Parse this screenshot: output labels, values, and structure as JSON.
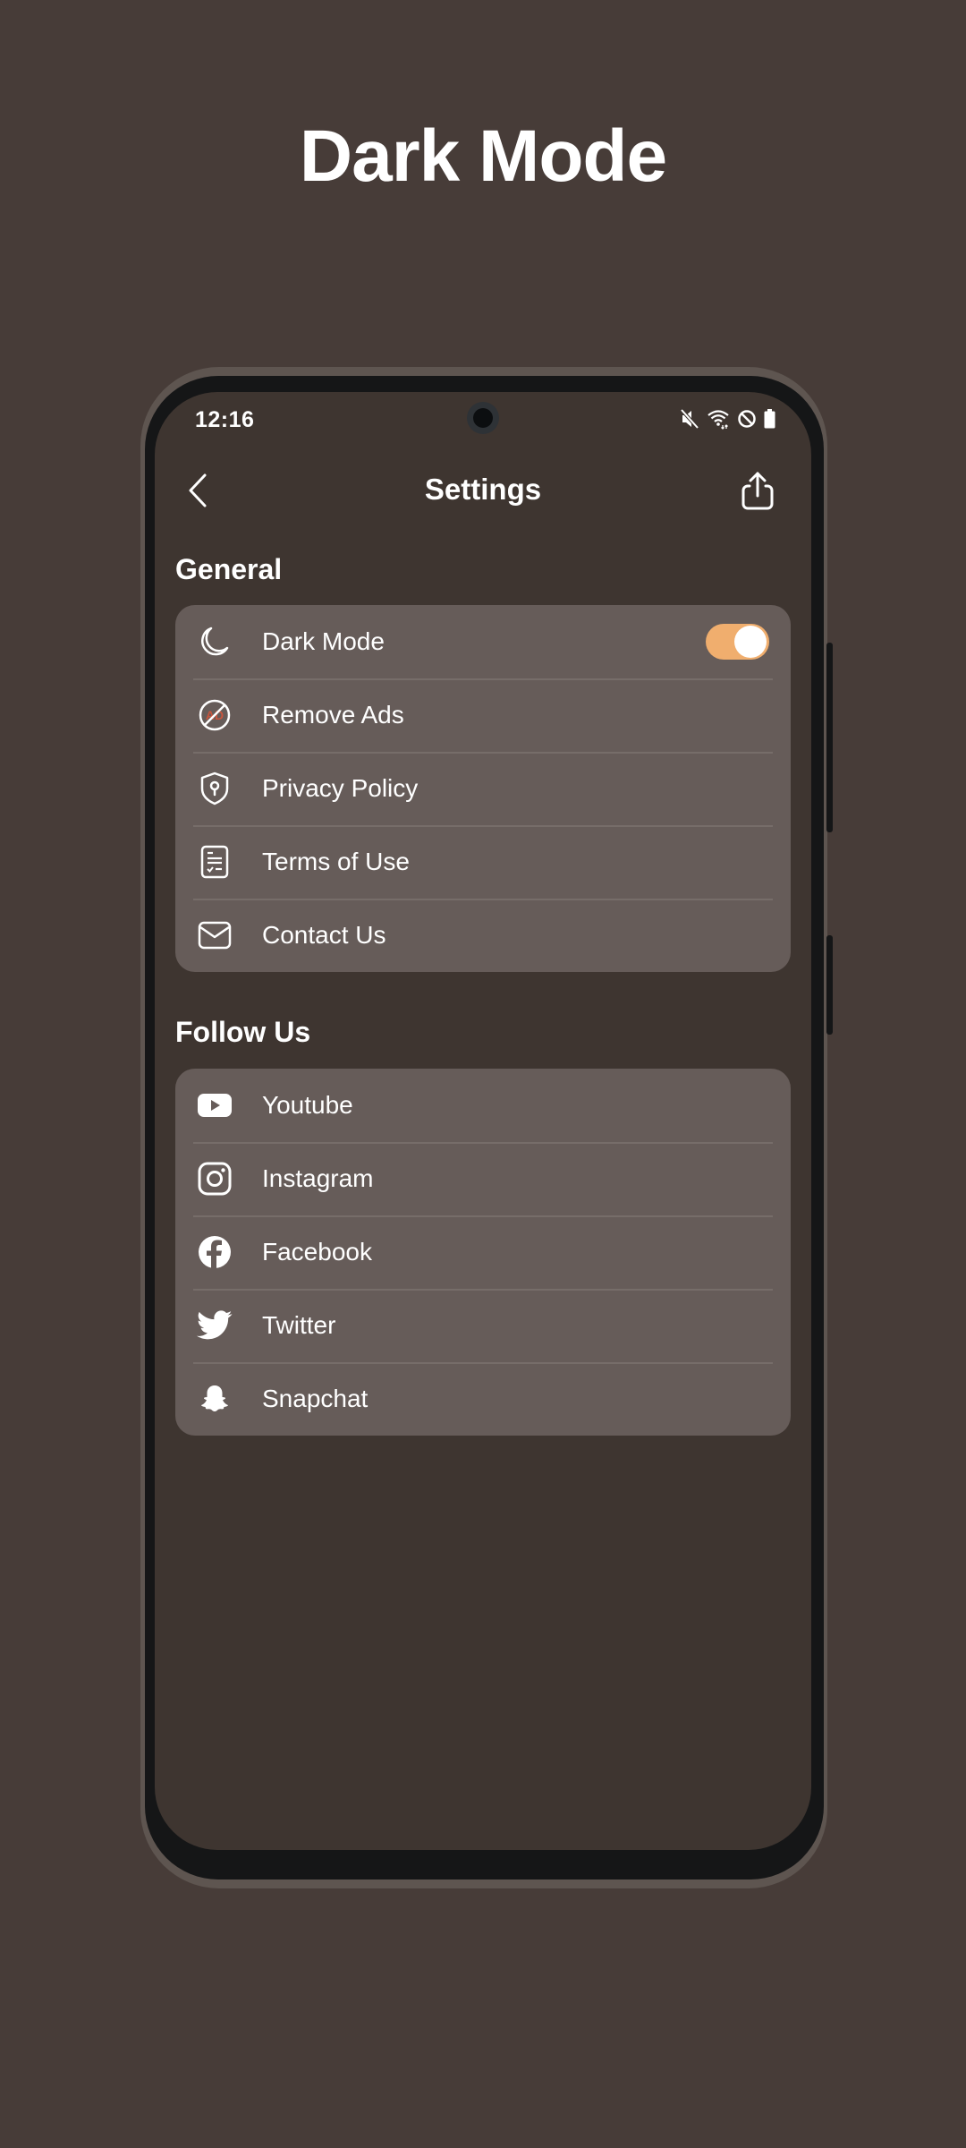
{
  "promo": {
    "title": "Dark Mode"
  },
  "status_bar": {
    "time": "12:16",
    "icons": [
      "mute-icon",
      "wifi-icon",
      "do-not-disturb-icon",
      "battery-icon"
    ]
  },
  "header": {
    "title": "Settings",
    "back_icon": "chevron-left-icon",
    "share_icon": "share-icon"
  },
  "general": {
    "title": "General",
    "items": [
      {
        "label": "Dark Mode",
        "icon": "moon-icon",
        "toggle": true,
        "toggle_on": true
      },
      {
        "label": "Remove Ads",
        "icon": "no-ads-icon"
      },
      {
        "label": "Privacy Policy",
        "icon": "shield-icon"
      },
      {
        "label": "Terms of Use",
        "icon": "document-icon"
      },
      {
        "label": "Contact Us",
        "icon": "mail-icon"
      }
    ]
  },
  "follow_us": {
    "title": "Follow Us",
    "items": [
      {
        "label": "Youtube",
        "icon": "youtube-icon"
      },
      {
        "label": "Instagram",
        "icon": "instagram-icon"
      },
      {
        "label": "Facebook",
        "icon": "facebook-icon"
      },
      {
        "label": "Twitter",
        "icon": "twitter-icon"
      },
      {
        "label": "Snapchat",
        "icon": "snapchat-icon"
      }
    ]
  },
  "colors": {
    "background": "#473C38",
    "screen": "#3E3530",
    "card": "#665C59",
    "accent_toggle": "#F0AE6E",
    "ads_icon_accent": "#C8553D"
  }
}
